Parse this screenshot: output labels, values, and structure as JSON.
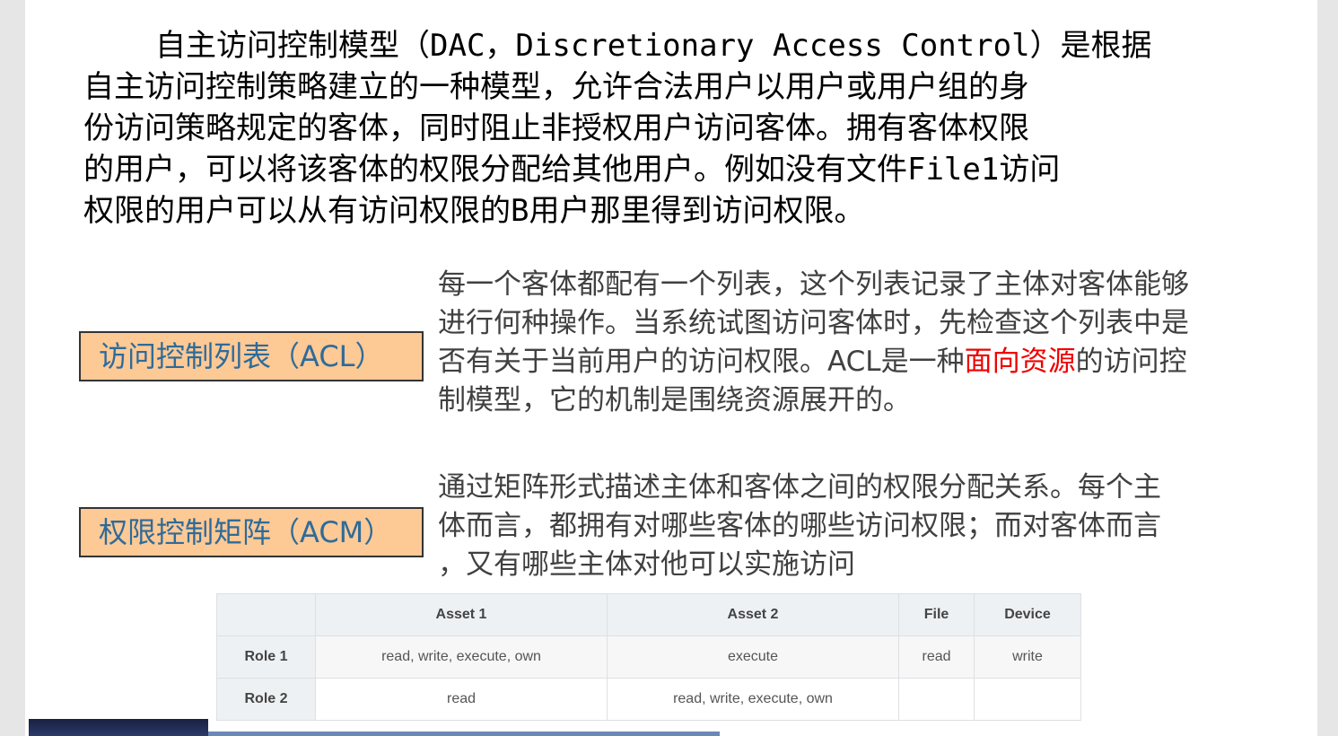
{
  "intro": {
    "lines": [
      "自主访问控制模型（DAC，Discretionary Access Control）是根据",
      "自主访问控制策略建立的一种模型，允许合法用户以用户或用户组的身",
      "份访问策略规定的客体，同时阻止非授权用户访问客体。拥有客体权限",
      "的用户，可以将该客体的权限分配给其他用户。例如没有文件File1访问",
      "权限的用户可以从有访问权限的B用户那里得到访问权限。"
    ]
  },
  "acl": {
    "label": "访问控制列表（ACL）",
    "lines": [
      "每一个客体都配有一个列表，这个列表记录了主体对客体能够",
      "进行何种操作。当系统试图访问客体时，先检查这个列表中是",
      "否有关于当前用户的访问权限。ACL是一种"
    ],
    "highlight": "面向资源",
    "after": "的访问控",
    "last": "制模型，它的机制是围绕资源展开的。",
    "highlight_color": "#ee0000"
  },
  "acm": {
    "label": "权限控制矩阵（ACM）",
    "lines": [
      "通过矩阵形式描述主体和客体之间的权限分配关系。每个主",
      "体而言，都拥有对哪些客体的哪些访问权限；而对客体而言",
      "，又有哪些主体对他可以实施访问"
    ]
  },
  "table": {
    "headers": [
      "",
      "Asset 1",
      "Asset 2",
      "File",
      "Device"
    ],
    "rows": [
      [
        "Role 1",
        "read, write, execute, own",
        "execute",
        "read",
        "write"
      ],
      [
        "Role 2",
        "read",
        "read, write, execute, own",
        "",
        ""
      ]
    ]
  }
}
